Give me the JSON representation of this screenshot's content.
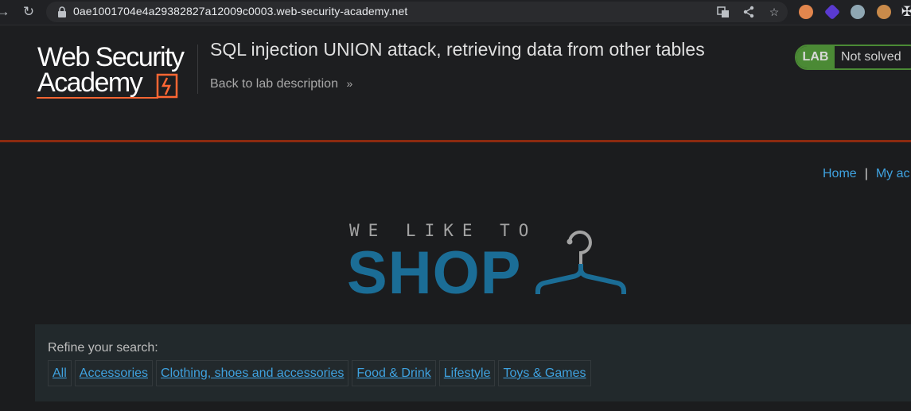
{
  "browser": {
    "url": "0ae1001704e4a29382827a12009c0003.web-security-academy.net",
    "icons": [
      "back-icon",
      "reload-icon",
      "lock-icon",
      "translate-icon",
      "share-icon",
      "star-icon",
      "extensions-icon"
    ]
  },
  "academy": {
    "logo_line1": "Web Security",
    "logo_line2": "Academy",
    "lab_title": "SQL injection UNION attack, retrieving data from other tables",
    "back_link": "Back to lab description",
    "status_badge": "LAB",
    "status_text": "Not solved",
    "colors": {
      "accent_orange": "#8c2a10",
      "lab_green": "#4b8a35",
      "logo_orange": "#ff6633"
    }
  },
  "shop": {
    "nav": {
      "home": "Home",
      "separator": "|",
      "my_account": "My ac"
    },
    "logo_top": "WE LIKE TO",
    "logo_main": "SHOP",
    "refine_label": "Refine your search:",
    "categories": [
      "All",
      "Accessories",
      "Clothing, shoes and accessories",
      "Food & Drink",
      "Lifestyle",
      "Toys & Games"
    ],
    "colors": {
      "link_blue": "#3fa2e0",
      "shop_blue": "#1b6d96"
    }
  }
}
